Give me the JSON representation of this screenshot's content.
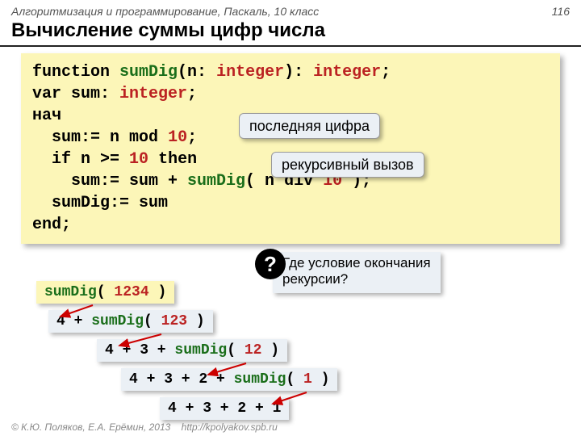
{
  "header": {
    "left": "Алгоритмизация и программирование, Паскаль, 10 класс",
    "page": "116"
  },
  "title": "Вычисление суммы цифр числа",
  "code": {
    "l1a": "function ",
    "l1fn": "sumDig",
    "l1b": "(n: ",
    "l1ty1": "integer",
    "l1c": "): ",
    "l1ty2": "integer",
    "l1d": ";",
    "l2a": "var sum: ",
    "l2ty": "integer",
    "l2b": ";",
    "l3": "нач",
    "l4a": "  sum:= n ",
    "l4kw": "mod",
    "l4b": " ",
    "l4n": "10",
    "l4c": ";",
    "l5a": "  if n >= ",
    "l5n": "10",
    "l5b": " ",
    "l5kw": "then",
    "l6a": "    sum:= sum + ",
    "l6fn": "sumDig",
    "l6b": "( n ",
    "l6kw": "div",
    "l6c": " ",
    "l6n": "10",
    "l6d": " );",
    "l7": "  sumDig:= sum",
    "l8": "end;"
  },
  "callouts": {
    "last_digit": "последняя цифра",
    "recursive": "рекурсивный вызов"
  },
  "question": {
    "line1": "Где условие окончания",
    "line2": "рекурсии?",
    "mark": "?"
  },
  "trace": {
    "t1a": "sumDig",
    "t1b": "( ",
    "t1n": "1234",
    "t1c": " )",
    "t2a": "4 + ",
    "t2fn": "sumDig",
    "t2b": "( ",
    "t2n": "123",
    "t2c": " )",
    "t3a": "4 + 3 + ",
    "t3fn": "sumDig",
    "t3b": "( ",
    "t3n": "12",
    "t3c": " )",
    "t4a": "4 + 3 + 2 + ",
    "t4fn": "sumDig",
    "t4b": "( ",
    "t4n": "1",
    "t4c": " )",
    "t5": "4 + 3 + 2 + 1"
  },
  "footer": {
    "copy": "© К.Ю. Поляков, Е.А. Ерёмин, 2013",
    "url": "http://kpolyakov.spb.ru"
  },
  "colors": {
    "arrow": "#c00"
  }
}
